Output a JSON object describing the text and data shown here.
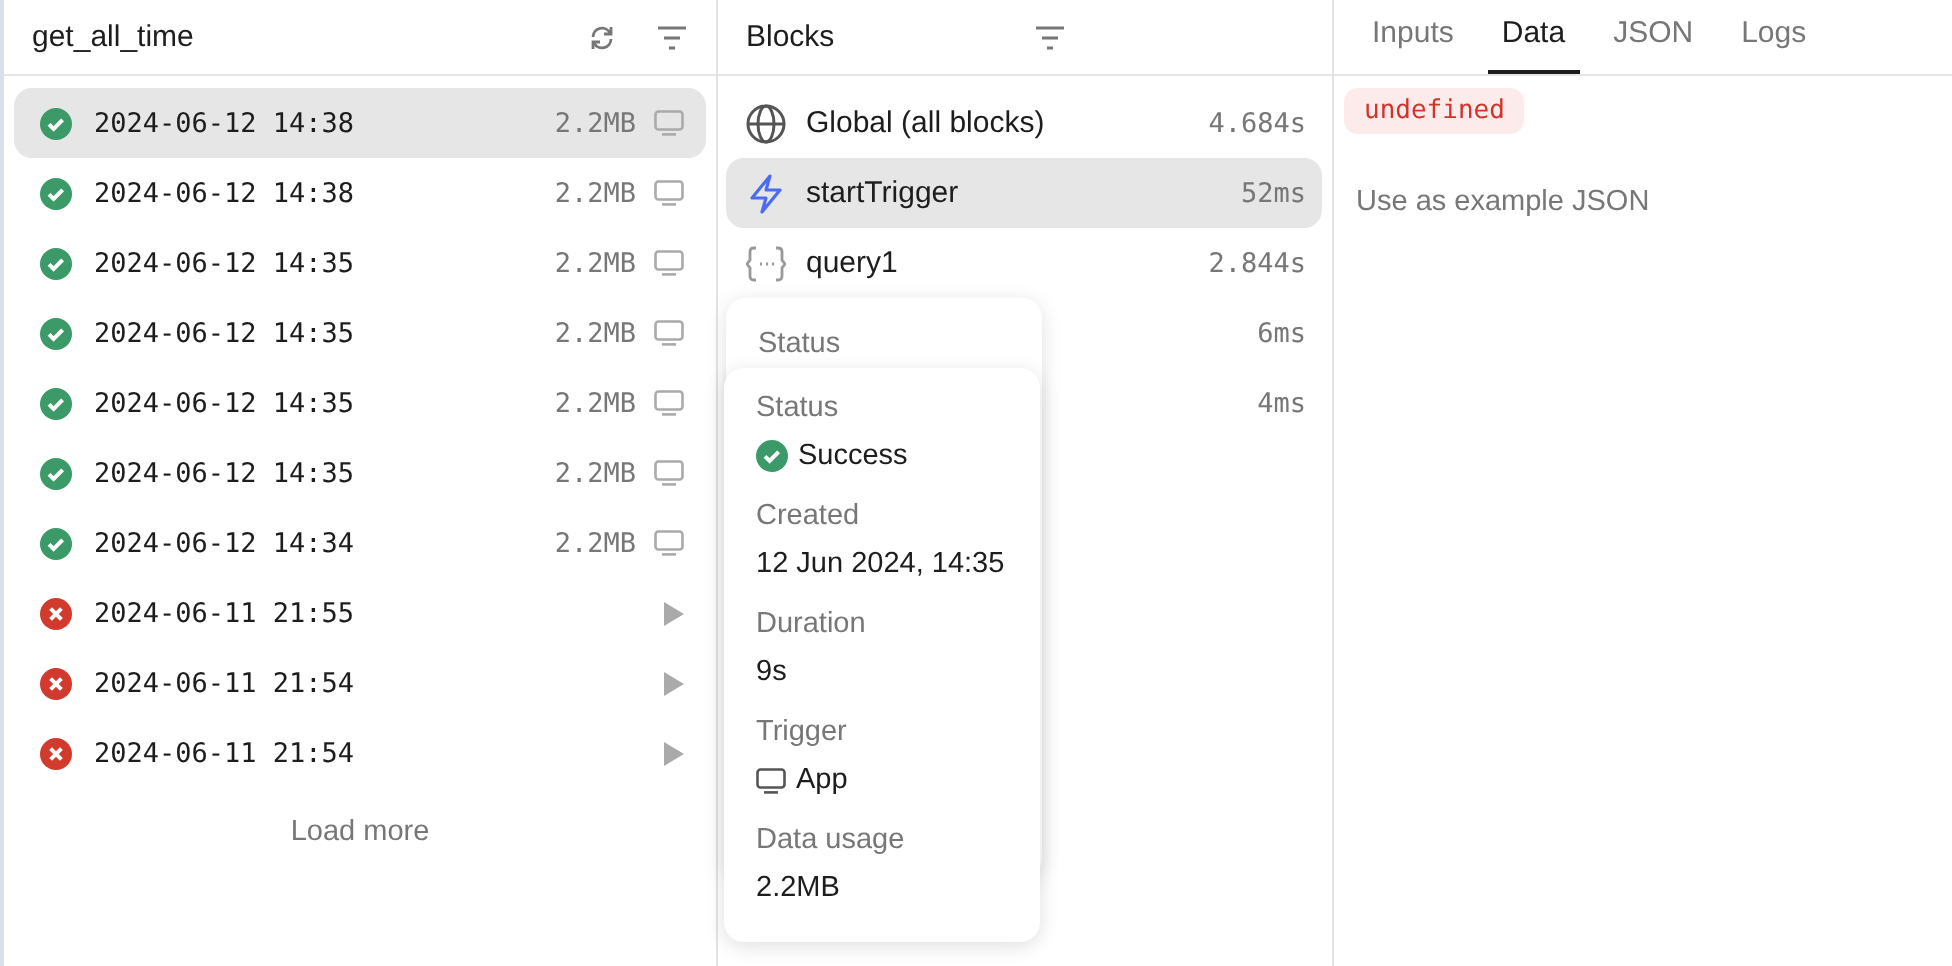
{
  "runs_panel": {
    "title": "get_all_time",
    "runs": [
      {
        "failed": false,
        "time": "2024-06-12 14:38",
        "size": "2.2MB",
        "selected": true
      },
      {
        "failed": false,
        "time": "2024-06-12 14:38",
        "size": "2.2MB",
        "selected": false
      },
      {
        "failed": false,
        "time": "2024-06-12 14:35",
        "size": "2.2MB",
        "selected": false
      },
      {
        "failed": false,
        "time": "2024-06-12 14:35",
        "size": "2.2MB",
        "selected": false
      },
      {
        "failed": false,
        "time": "2024-06-12 14:35",
        "size": "2.2MB",
        "selected": false
      },
      {
        "failed": false,
        "time": "2024-06-12 14:35",
        "size": "2.2MB",
        "selected": false
      },
      {
        "failed": false,
        "time": "2024-06-12 14:34",
        "size": "2.2MB",
        "selected": false
      },
      {
        "failed": true,
        "time": "2024-06-11 21:55",
        "selected": false
      },
      {
        "failed": true,
        "time": "2024-06-11 21:54",
        "selected": false
      },
      {
        "failed": true,
        "time": "2024-06-11 21:54",
        "selected": false
      }
    ],
    "load_more": "Load more"
  },
  "blocks_panel": {
    "title": "Blocks",
    "blocks": [
      {
        "kind": "global",
        "name": "Global (all blocks)",
        "duration": "4.684s",
        "selected": false
      },
      {
        "kind": "trigger",
        "name": "startTrigger",
        "duration": "52ms",
        "selected": true
      },
      {
        "kind": "query",
        "name": "query1",
        "duration": "2.844s",
        "selected": false
      },
      {
        "kind": "hidden",
        "duration": "6ms",
        "selected": false
      },
      {
        "kind": "hidden",
        "duration": "4ms",
        "selected": false
      }
    ]
  },
  "tooltip_back": {
    "label": "Status"
  },
  "tooltip_front": {
    "fields": [
      {
        "label": "Status",
        "kind": "status",
        "value": "Success"
      },
      {
        "label": "Created",
        "kind": "text",
        "value": "12 Jun 2024, 14:35"
      },
      {
        "label": "Duration",
        "kind": "text",
        "value": "9s"
      },
      {
        "label": "Trigger",
        "kind": "trigger",
        "value": "App"
      },
      {
        "label": "Data usage",
        "kind": "text",
        "value": "2.2MB"
      }
    ]
  },
  "output_panel": {
    "tabs": [
      {
        "label": "Inputs",
        "selected": false
      },
      {
        "label": "Data",
        "selected": true
      },
      {
        "label": "JSON",
        "selected": false
      },
      {
        "label": "Logs",
        "selected": false
      }
    ],
    "value_badge": "undefined",
    "example_link": "Use as example JSON"
  }
}
